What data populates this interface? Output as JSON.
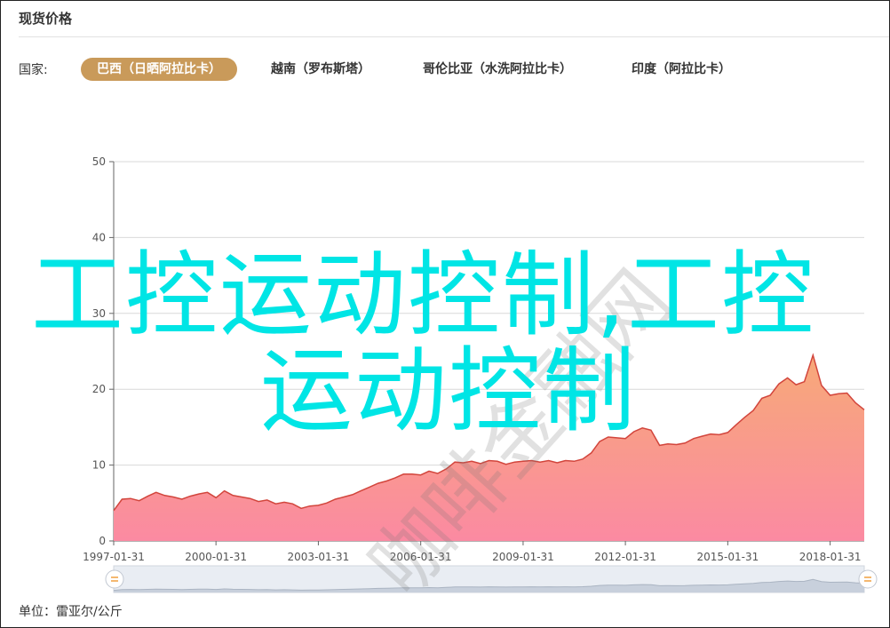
{
  "header": {
    "title": "现货价格"
  },
  "filter": {
    "label": "国家:",
    "tabs": [
      {
        "label": "巴西（日晒阿拉比卡）",
        "active": true
      },
      {
        "label": "越南（罗布斯塔）",
        "active": false
      },
      {
        "label": "哥伦比亚（水洗阿拉比卡）",
        "active": false
      },
      {
        "label": "印度（阿拉比卡）",
        "active": false
      }
    ]
  },
  "footer": {
    "unit": "单位：雷亚尔/公斤"
  },
  "overlay": {
    "line1": "工控运动控制,工控",
    "line2": "运动控制"
  },
  "watermark": {
    "text": "咖啡金融网"
  },
  "colors": {
    "accent": "#c99a5a",
    "series_line": "#d2453c",
    "fill_top": "#f7a978",
    "fill_bottom": "#fb8aa2",
    "overlay": "#00e5e5"
  },
  "chart_data": {
    "type": "area",
    "ylim": [
      0,
      50
    ],
    "yticks": [
      0,
      10,
      20,
      30,
      40,
      50
    ],
    "xlim": [
      "1997-01-31",
      "2019-01-31"
    ],
    "xticks": [
      "1997-01-31",
      "2000-01-31",
      "2003-01-31",
      "2006-01-31",
      "2009-01-31",
      "2012-01-31",
      "2015-01-31",
      "2018-01-31"
    ],
    "grid": true,
    "dataZoom": true,
    "x": [
      "1997-01-31",
      "1997-04-30",
      "1997-07-31",
      "1997-10-31",
      "1998-01-31",
      "1998-04-30",
      "1998-07-31",
      "1998-10-31",
      "1999-01-31",
      "1999-04-30",
      "1999-07-31",
      "1999-10-31",
      "2000-01-31",
      "2000-04-30",
      "2000-07-31",
      "2000-10-31",
      "2001-01-31",
      "2001-04-30",
      "2001-07-31",
      "2001-10-31",
      "2002-01-31",
      "2002-04-30",
      "2002-07-31",
      "2002-10-31",
      "2003-01-31",
      "2003-04-30",
      "2003-07-31",
      "2003-10-31",
      "2004-01-31",
      "2004-04-30",
      "2004-07-31",
      "2004-10-31",
      "2005-01-31",
      "2005-04-30",
      "2005-07-31",
      "2005-10-31",
      "2006-01-31",
      "2006-04-30",
      "2006-07-31",
      "2006-10-31",
      "2007-01-31",
      "2007-04-30",
      "2007-07-31",
      "2007-10-31",
      "2008-01-31",
      "2008-04-30",
      "2008-07-31",
      "2008-10-31",
      "2009-01-31",
      "2009-04-30",
      "2009-07-31",
      "2009-10-31",
      "2010-01-31",
      "2010-04-30",
      "2010-07-31",
      "2010-10-31",
      "2011-01-31",
      "2011-04-30",
      "2011-07-31",
      "2011-10-31",
      "2012-01-31",
      "2012-04-30",
      "2012-07-31",
      "2012-10-31",
      "2013-01-31",
      "2013-04-30",
      "2013-07-31",
      "2013-10-31",
      "2014-01-31",
      "2014-04-30",
      "2014-07-31",
      "2014-10-31",
      "2015-01-31",
      "2015-04-30",
      "2015-07-31",
      "2015-10-31",
      "2016-01-31",
      "2016-04-30",
      "2016-07-31",
      "2016-10-31",
      "2017-01-31",
      "2017-04-30",
      "2017-07-31",
      "2017-10-31",
      "2018-01-31",
      "2018-04-30",
      "2018-07-31",
      "2018-10-31",
      "2019-01-31"
    ],
    "series": [
      {
        "values": [
          4.0,
          5.5,
          5.6,
          5.3,
          5.9,
          6.4,
          6.0,
          5.8,
          5.5,
          5.9,
          6.2,
          6.4,
          5.7,
          6.6,
          6.0,
          5.8,
          5.6,
          5.2,
          5.4,
          4.9,
          5.1,
          4.9,
          4.3,
          4.6,
          4.7,
          5.0,
          5.5,
          5.8,
          6.1,
          6.6,
          7.1,
          7.6,
          7.9,
          8.3,
          8.8,
          8.8,
          8.7,
          9.2,
          8.9,
          9.5,
          10.4,
          10.3,
          10.5,
          10.2,
          10.6,
          10.5,
          10.1,
          10.4,
          10.5,
          10.6,
          10.4,
          10.6,
          10.3,
          10.6,
          10.5,
          10.8,
          11.6,
          13.1,
          13.7,
          13.6,
          13.5,
          14.4,
          14.9,
          14.6,
          12.6,
          12.8,
          12.7,
          12.9,
          13.5,
          13.8,
          14.1,
          14.0,
          14.3,
          15.3,
          16.3,
          17.2,
          18.8,
          19.2,
          20.7,
          21.5,
          20.6,
          21.0,
          24.5,
          20.5,
          19.2,
          19.4,
          19.5,
          18.2,
          17.3
        ]
      }
    ]
  }
}
